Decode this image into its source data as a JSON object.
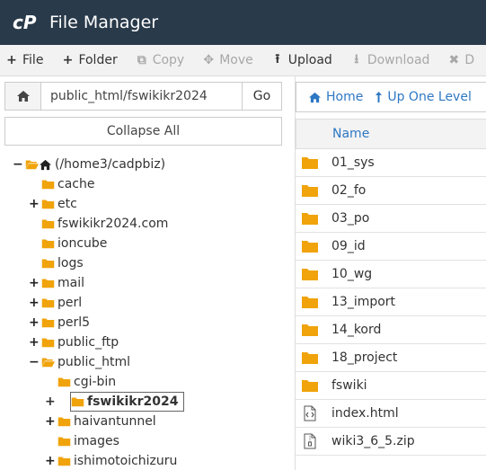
{
  "app": {
    "title": "File Manager"
  },
  "colors": {
    "titlebar": "#293a4a",
    "folder": "#f0a30a",
    "link": "#2e78c4"
  },
  "toolbar": [
    {
      "icon": "plus-icon",
      "glyph": "+",
      "label": "File",
      "enabled": true
    },
    {
      "icon": "plus-icon",
      "glyph": "+",
      "label": "Folder",
      "enabled": true
    },
    {
      "icon": "copy-icon",
      "glyph": "⧉",
      "label": "Copy",
      "enabled": false
    },
    {
      "icon": "move-icon",
      "glyph": "✥",
      "label": "Move",
      "enabled": false
    },
    {
      "icon": "upload-icon",
      "glyph": "⭱",
      "label": "Upload",
      "enabled": true
    },
    {
      "icon": "download-icon",
      "glyph": "⭳",
      "label": "Download",
      "enabled": false
    },
    {
      "icon": "delete-icon",
      "glyph": "✖",
      "label": "D",
      "enabled": false
    }
  ],
  "pathbar": {
    "value": "public_html/fswikikr2024",
    "go_label": "Go"
  },
  "collapse_label": "Collapse All",
  "tree": [
    {
      "label": "(/home3/cadpbiz)",
      "toggle": "−",
      "icon": "home",
      "depth": 0
    },
    {
      "label": "cache",
      "toggle": "",
      "icon": "folder",
      "depth": 1
    },
    {
      "label": "etc",
      "toggle": "+",
      "icon": "folder",
      "depth": 1
    },
    {
      "label": "fswikikr2024.com",
      "toggle": "",
      "icon": "folder",
      "depth": 1
    },
    {
      "label": "ioncube",
      "toggle": "",
      "icon": "folder",
      "depth": 1
    },
    {
      "label": "logs",
      "toggle": "",
      "icon": "folder",
      "depth": 1
    },
    {
      "label": "mail",
      "toggle": "+",
      "icon": "folder",
      "depth": 1
    },
    {
      "label": "perl",
      "toggle": "+",
      "icon": "folder",
      "depth": 1
    },
    {
      "label": "perl5",
      "toggle": "+",
      "icon": "folder",
      "depth": 1
    },
    {
      "label": "public_ftp",
      "toggle": "+",
      "icon": "folder",
      "depth": 1
    },
    {
      "label": "public_html",
      "toggle": "−",
      "icon": "folder-open",
      "depth": 1
    },
    {
      "label": "cgi-bin",
      "toggle": "",
      "icon": "folder",
      "depth": 2
    },
    {
      "label": "fswikikr2024",
      "toggle": "+",
      "icon": "folder",
      "depth": 2,
      "selected": true
    },
    {
      "label": "haivantunnel",
      "toggle": "+",
      "icon": "folder",
      "depth": 2
    },
    {
      "label": "images",
      "toggle": "",
      "icon": "folder",
      "depth": 2
    },
    {
      "label": "ishimotoichizuru",
      "toggle": "+",
      "icon": "folder",
      "depth": 2
    }
  ],
  "nav": {
    "home_label": "Home",
    "up_label": "Up One Level"
  },
  "files": {
    "header": "Name",
    "rows": [
      {
        "name": "01_sys",
        "type": "folder"
      },
      {
        "name": "02_fo",
        "type": "folder"
      },
      {
        "name": "03_po",
        "type": "folder"
      },
      {
        "name": "09_id",
        "type": "folder"
      },
      {
        "name": "10_wg",
        "type": "folder"
      },
      {
        "name": "13_import",
        "type": "folder"
      },
      {
        "name": "14_kord",
        "type": "folder"
      },
      {
        "name": "18_project",
        "type": "folder"
      },
      {
        "name": "fswiki",
        "type": "folder"
      },
      {
        "name": "index.html",
        "type": "html"
      },
      {
        "name": "wiki3_6_5.zip",
        "type": "zip"
      }
    ]
  }
}
